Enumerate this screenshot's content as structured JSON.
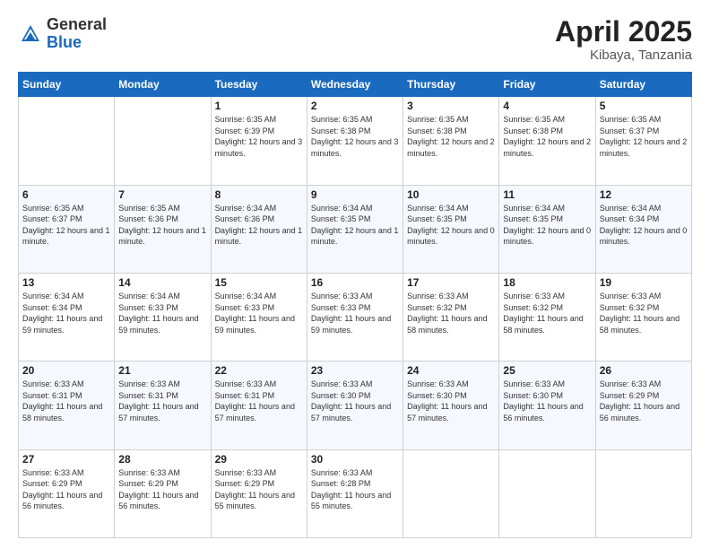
{
  "header": {
    "logo_general": "General",
    "logo_blue": "Blue",
    "title": "April 2025",
    "location": "Kibaya, Tanzania"
  },
  "weekdays": [
    "Sunday",
    "Monday",
    "Tuesday",
    "Wednesday",
    "Thursday",
    "Friday",
    "Saturday"
  ],
  "rows": [
    [
      {
        "day": "",
        "info": ""
      },
      {
        "day": "",
        "info": ""
      },
      {
        "day": "1",
        "info": "Sunrise: 6:35 AM\nSunset: 6:39 PM\nDaylight: 12 hours and 3 minutes."
      },
      {
        "day": "2",
        "info": "Sunrise: 6:35 AM\nSunset: 6:38 PM\nDaylight: 12 hours and 3 minutes."
      },
      {
        "day": "3",
        "info": "Sunrise: 6:35 AM\nSunset: 6:38 PM\nDaylight: 12 hours and 2 minutes."
      },
      {
        "day": "4",
        "info": "Sunrise: 6:35 AM\nSunset: 6:38 PM\nDaylight: 12 hours and 2 minutes."
      },
      {
        "day": "5",
        "info": "Sunrise: 6:35 AM\nSunset: 6:37 PM\nDaylight: 12 hours and 2 minutes."
      }
    ],
    [
      {
        "day": "6",
        "info": "Sunrise: 6:35 AM\nSunset: 6:37 PM\nDaylight: 12 hours and 1 minute."
      },
      {
        "day": "7",
        "info": "Sunrise: 6:35 AM\nSunset: 6:36 PM\nDaylight: 12 hours and 1 minute."
      },
      {
        "day": "8",
        "info": "Sunrise: 6:34 AM\nSunset: 6:36 PM\nDaylight: 12 hours and 1 minute."
      },
      {
        "day": "9",
        "info": "Sunrise: 6:34 AM\nSunset: 6:35 PM\nDaylight: 12 hours and 1 minute."
      },
      {
        "day": "10",
        "info": "Sunrise: 6:34 AM\nSunset: 6:35 PM\nDaylight: 12 hours and 0 minutes."
      },
      {
        "day": "11",
        "info": "Sunrise: 6:34 AM\nSunset: 6:35 PM\nDaylight: 12 hours and 0 minutes."
      },
      {
        "day": "12",
        "info": "Sunrise: 6:34 AM\nSunset: 6:34 PM\nDaylight: 12 hours and 0 minutes."
      }
    ],
    [
      {
        "day": "13",
        "info": "Sunrise: 6:34 AM\nSunset: 6:34 PM\nDaylight: 11 hours and 59 minutes."
      },
      {
        "day": "14",
        "info": "Sunrise: 6:34 AM\nSunset: 6:33 PM\nDaylight: 11 hours and 59 minutes."
      },
      {
        "day": "15",
        "info": "Sunrise: 6:34 AM\nSunset: 6:33 PM\nDaylight: 11 hours and 59 minutes."
      },
      {
        "day": "16",
        "info": "Sunrise: 6:33 AM\nSunset: 6:33 PM\nDaylight: 11 hours and 59 minutes."
      },
      {
        "day": "17",
        "info": "Sunrise: 6:33 AM\nSunset: 6:32 PM\nDaylight: 11 hours and 58 minutes."
      },
      {
        "day": "18",
        "info": "Sunrise: 6:33 AM\nSunset: 6:32 PM\nDaylight: 11 hours and 58 minutes."
      },
      {
        "day": "19",
        "info": "Sunrise: 6:33 AM\nSunset: 6:32 PM\nDaylight: 11 hours and 58 minutes."
      }
    ],
    [
      {
        "day": "20",
        "info": "Sunrise: 6:33 AM\nSunset: 6:31 PM\nDaylight: 11 hours and 58 minutes."
      },
      {
        "day": "21",
        "info": "Sunrise: 6:33 AM\nSunset: 6:31 PM\nDaylight: 11 hours and 57 minutes."
      },
      {
        "day": "22",
        "info": "Sunrise: 6:33 AM\nSunset: 6:31 PM\nDaylight: 11 hours and 57 minutes."
      },
      {
        "day": "23",
        "info": "Sunrise: 6:33 AM\nSunset: 6:30 PM\nDaylight: 11 hours and 57 minutes."
      },
      {
        "day": "24",
        "info": "Sunrise: 6:33 AM\nSunset: 6:30 PM\nDaylight: 11 hours and 57 minutes."
      },
      {
        "day": "25",
        "info": "Sunrise: 6:33 AM\nSunset: 6:30 PM\nDaylight: 11 hours and 56 minutes."
      },
      {
        "day": "26",
        "info": "Sunrise: 6:33 AM\nSunset: 6:29 PM\nDaylight: 11 hours and 56 minutes."
      }
    ],
    [
      {
        "day": "27",
        "info": "Sunrise: 6:33 AM\nSunset: 6:29 PM\nDaylight: 11 hours and 56 minutes."
      },
      {
        "day": "28",
        "info": "Sunrise: 6:33 AM\nSunset: 6:29 PM\nDaylight: 11 hours and 56 minutes."
      },
      {
        "day": "29",
        "info": "Sunrise: 6:33 AM\nSunset: 6:29 PM\nDaylight: 11 hours and 55 minutes."
      },
      {
        "day": "30",
        "info": "Sunrise: 6:33 AM\nSunset: 6:28 PM\nDaylight: 11 hours and 55 minutes."
      },
      {
        "day": "",
        "info": ""
      },
      {
        "day": "",
        "info": ""
      },
      {
        "day": "",
        "info": ""
      }
    ]
  ]
}
